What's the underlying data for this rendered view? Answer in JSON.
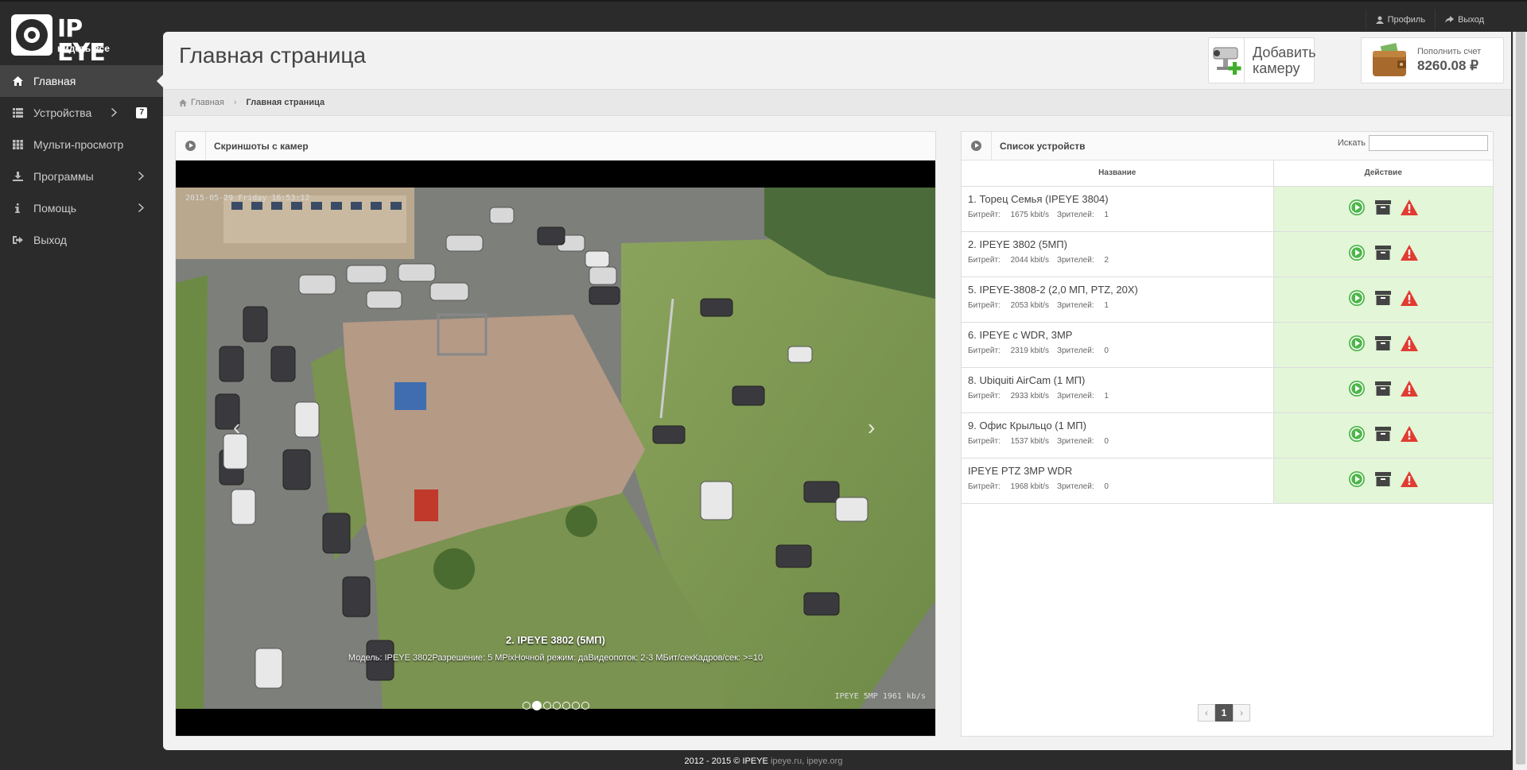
{
  "brand": {
    "name": "IP EYE",
    "tagline": "видеть все"
  },
  "top_links": [
    {
      "label": "Профиль",
      "icon": "user-icon"
    },
    {
      "label": "Выход",
      "icon": "share-icon"
    }
  ],
  "sidebar": {
    "items": [
      {
        "label": "Главная",
        "icon": "home-icon",
        "active": true
      },
      {
        "label": "Устройства",
        "icon": "list-icon",
        "badge": "7"
      },
      {
        "label": "Мульти-просмотр",
        "icon": "grid-icon"
      },
      {
        "label": "Программы",
        "icon": "download-icon"
      },
      {
        "label": "Помощь",
        "icon": "info-icon"
      },
      {
        "label": "Выход",
        "icon": "logout-icon"
      }
    ]
  },
  "header": {
    "title": "Главная страница",
    "add_camera": {
      "line1": "Добавить",
      "line2": "камеру"
    },
    "balance": {
      "label": "Пополнить счет",
      "amount": "8260.08 ₽"
    }
  },
  "breadcrumb": {
    "home": "Главная",
    "current": "Главная страница"
  },
  "screenshots_panel": {
    "title": "Скриншоты с камер",
    "timestamp": "2015-05-29 Friday 16:53:12",
    "bitrate_overlay": "IPEYE 5MP 1961 kb/s",
    "caption_title": "2. IPEYE 3802 (5МП)",
    "caption_desc": "Модель: IPEYE 3802Разрешение: 5 МPixНочной режим: даВидеопоток: 2-3 МБит/секКадров/сек: >=10",
    "slides_count": 7,
    "active_slide": 1
  },
  "devices_panel": {
    "title": "Список устройств",
    "search_label": "Искать",
    "search_value": "",
    "columns": [
      "Название",
      "Действие"
    ],
    "meta_labels": {
      "bitrate": "Битрейт:",
      "viewers": "Зрителей:"
    },
    "devices": [
      {
        "name": "1. Торец Семья (IPEYE 3804)",
        "bitrate": "1675 kbit/s",
        "viewers": "1"
      },
      {
        "name": "2. IPEYE 3802 (5МП)",
        "bitrate": "2044 kbit/s",
        "viewers": "2"
      },
      {
        "name": "5. IPEYE-3808-2 (2,0 МП, PTZ, 20X)",
        "bitrate": "2053 kbit/s",
        "viewers": "1"
      },
      {
        "name": "6. IPEYE c WDR, 3MP",
        "bitrate": "2319 kbit/s",
        "viewers": "0"
      },
      {
        "name": "8. Ubiquiti AirCam (1 МП)",
        "bitrate": "2933 kbit/s",
        "viewers": "1"
      },
      {
        "name": "9. Офис Крыльцо (1 МП)",
        "bitrate": "1537 kbit/s",
        "viewers": "0"
      },
      {
        "name": "IPEYE PTZ 3MP WDR",
        "bitrate": "1968 kbit/s",
        "viewers": "0"
      }
    ],
    "pagination": {
      "prev": "‹",
      "current": "1",
      "next": "›"
    }
  },
  "footer": {
    "text": "2012 - 2015 © IPEYE",
    "link1": "ipeye.ru",
    "separator": ",",
    "link2": "ipeye.org"
  },
  "colors": {
    "sidebar_bg": "#2b2b2b",
    "action_bg": "#e3f6d8",
    "play": "#4cb648",
    "warn": "#e03c31"
  }
}
